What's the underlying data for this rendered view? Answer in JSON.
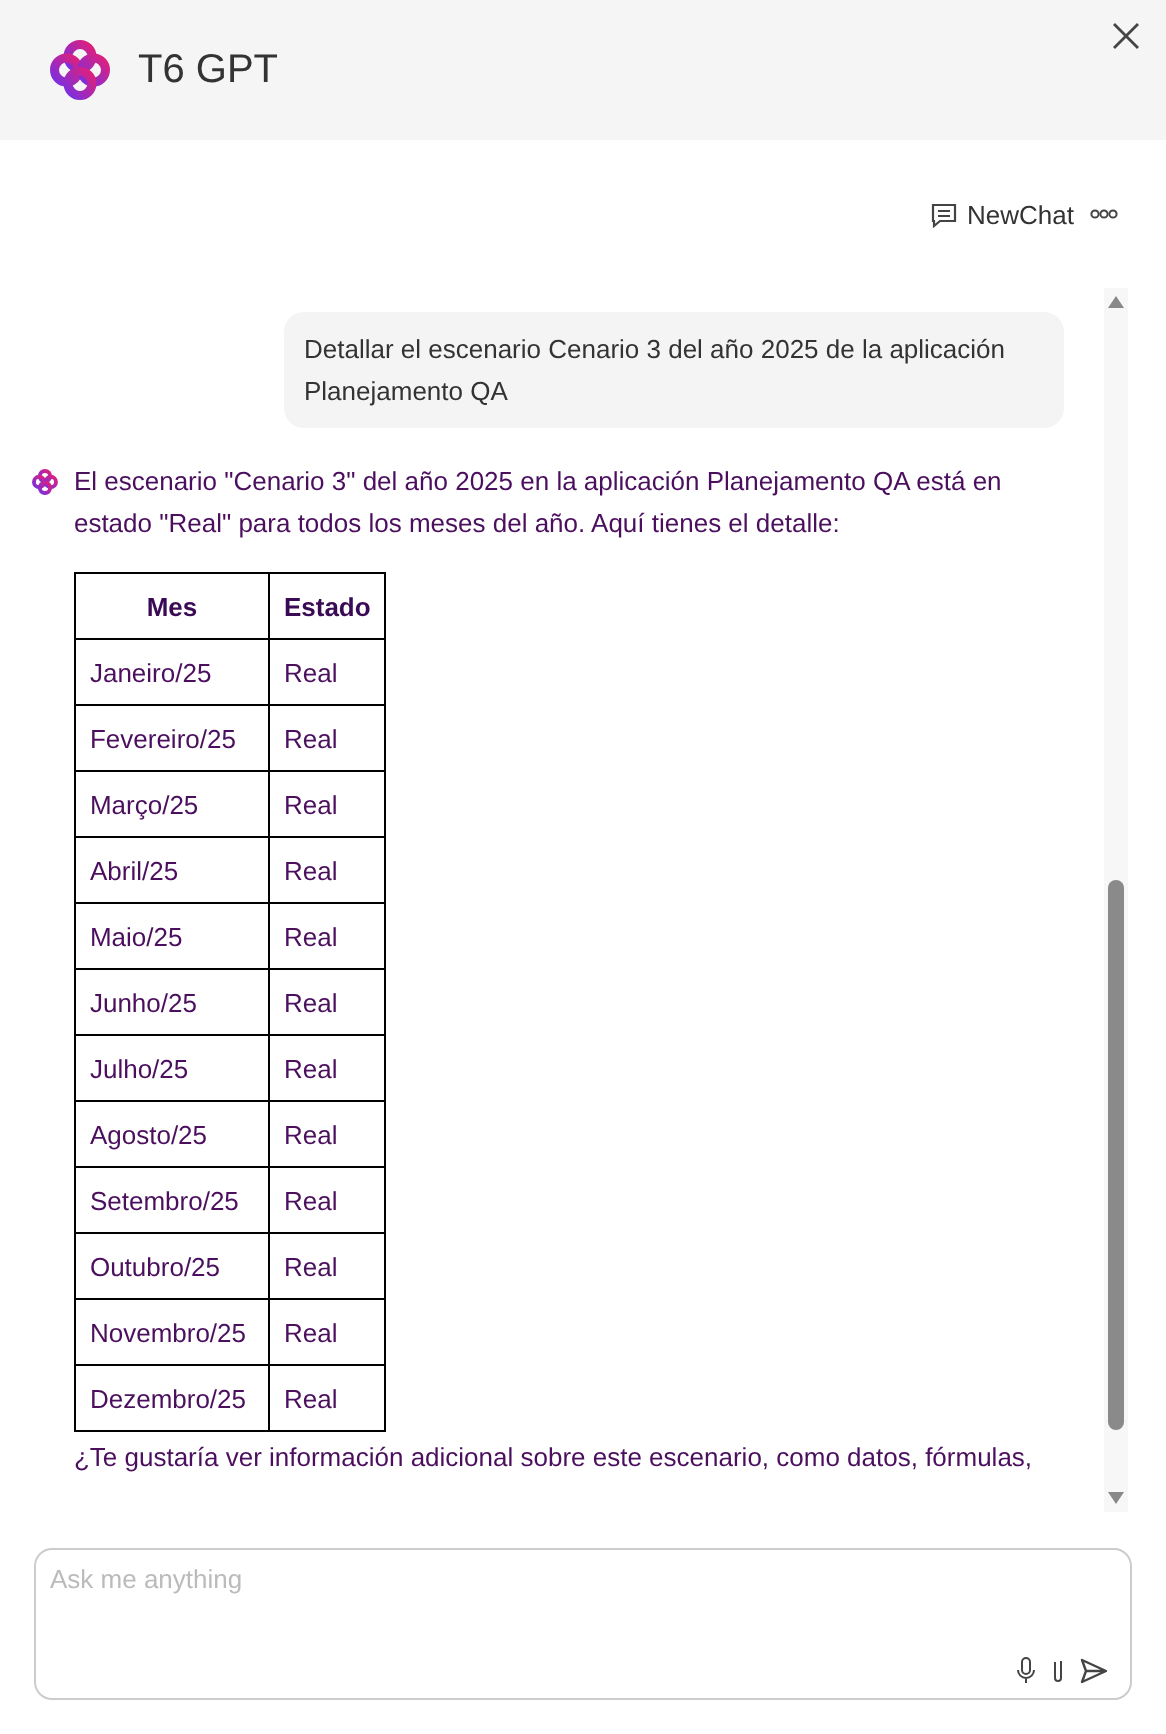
{
  "header": {
    "title": "T6 GPT"
  },
  "toolbar": {
    "new_chat": "NewChat"
  },
  "messages": [
    {
      "kind": "user",
      "text": "Detallar el escenario Cenario 3 del año 2025 de la aplicación Planejamento QA"
    },
    {
      "kind": "bot",
      "text": "El escenario \"Cenario 3\" del año 2025 en la aplicación Planejamento QA está en estado \"Real\" para todos los meses del año. Aquí tienes el detalle:",
      "table": {
        "columns": [
          "Mes",
          "Estado"
        ],
        "rows": [
          [
            "Janeiro/25",
            "Real"
          ],
          [
            "Fevereiro/25",
            "Real"
          ],
          [
            "Março/25",
            "Real"
          ],
          [
            "Abril/25",
            "Real"
          ],
          [
            "Maio/25",
            "Real"
          ],
          [
            "Junho/25",
            "Real"
          ],
          [
            "Julho/25",
            "Real"
          ],
          [
            "Agosto/25",
            "Real"
          ],
          [
            "Setembro/25",
            "Real"
          ],
          [
            "Outubro/25",
            "Real"
          ],
          [
            "Novembro/25",
            "Real"
          ],
          [
            "Dezembro/25",
            "Real"
          ]
        ]
      },
      "followup": "¿Te gustaría ver información adicional sobre este escenario, como datos, fórmulas,"
    }
  ],
  "input": {
    "placeholder": "Ask me anything"
  }
}
